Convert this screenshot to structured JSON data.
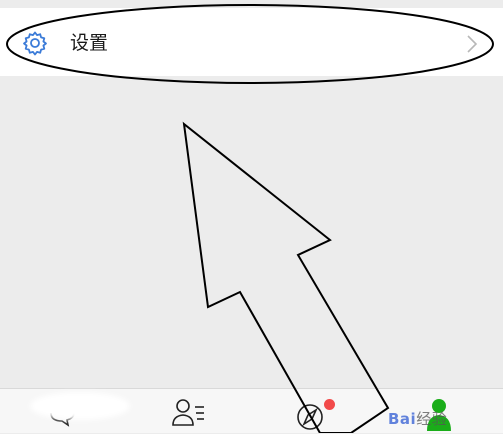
{
  "settings": {
    "label": "设置",
    "icon": "gear-icon",
    "accent": "#3b7bd8"
  },
  "tabbar": {
    "tabs": [
      {
        "name": "chats",
        "icon": "chat-icon"
      },
      {
        "name": "contacts",
        "icon": "contacts-icon"
      },
      {
        "name": "discover",
        "icon": "compass-icon",
        "badge": true
      },
      {
        "name": "me",
        "icon": "person-icon",
        "active": true
      }
    ],
    "badge_color": "#f24a4a",
    "active_color": "#1aad19"
  },
  "watermark": {
    "logo": "Bai",
    "text": "经验"
  }
}
